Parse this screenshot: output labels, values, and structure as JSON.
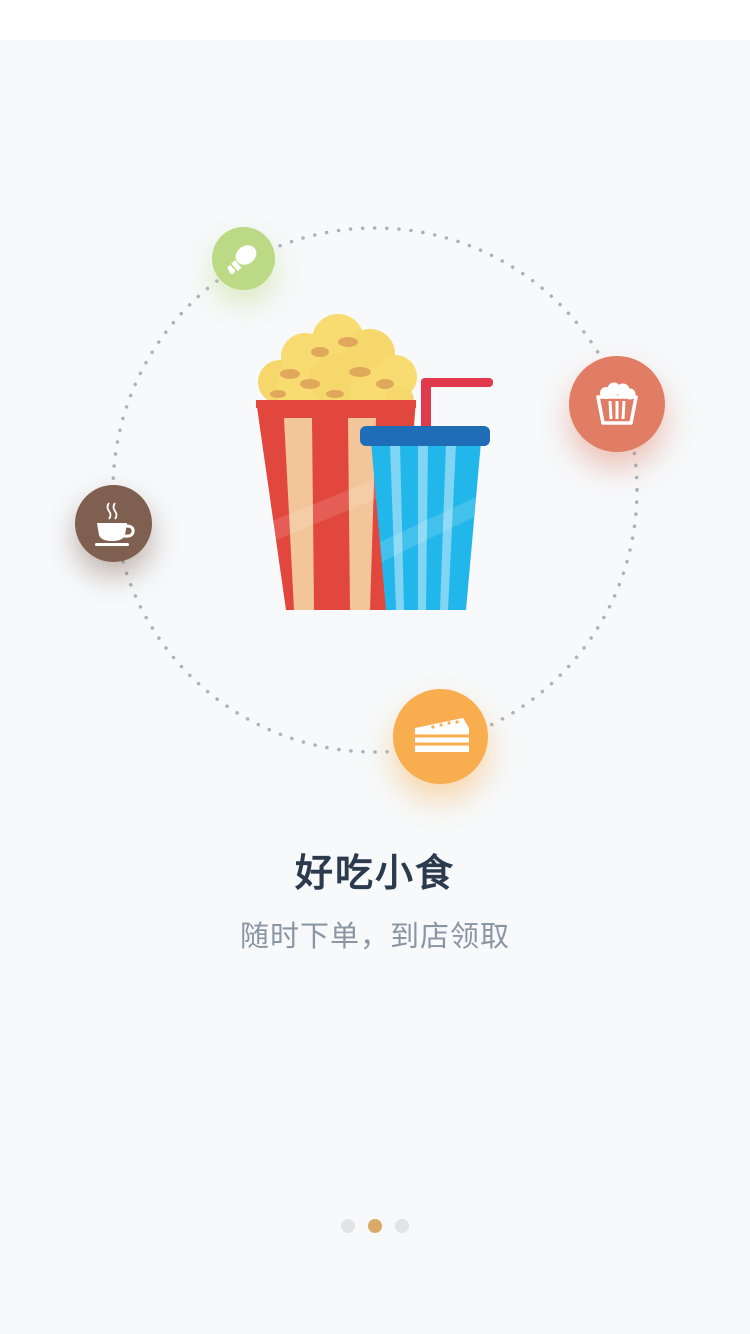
{
  "onboarding": {
    "title": "好吃小食",
    "subtitle": "随时下单，到店领取",
    "page_indicator": {
      "total": 3,
      "current": 2
    },
    "icons": [
      "chicken-leg-icon",
      "popcorn-icon",
      "coffee-cup-icon",
      "cake-icon",
      "popcorn-and-drink-illustration"
    ],
    "colors": {
      "chicken_bubble": "#bcd985",
      "popcorn_bubble": "#e07d64",
      "coffee_bubble": "#7f5f4f",
      "cake_bubble": "#f8ad4f",
      "active_dot": "#d9aa6a",
      "inactive_dot": "#e1e3e6"
    }
  }
}
